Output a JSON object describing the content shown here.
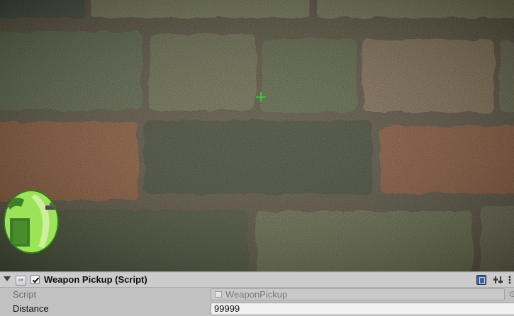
{
  "game_view": {
    "scene": "stone-brick-wall",
    "crosshair_icon": "crosshair-icon",
    "crosshair_color": "#3cd43c",
    "radar_icon": "radar-minimap-icon",
    "radar_color": "#6fd63a"
  },
  "inspector": {
    "component": {
      "title": "Weapon Pickup (Script)",
      "enabled": true,
      "icons": [
        "foldout-arrow-icon",
        "csharp-script-icon",
        "help-book-icon",
        "settings-icon",
        "context-menu-icon"
      ]
    },
    "properties": {
      "script": {
        "label": "Script",
        "value": "WeaponPickup"
      },
      "distance": {
        "label": "Distance",
        "value": "99999"
      }
    },
    "colors": {
      "panel_bg": "#c2c2c2",
      "header_bg": "#cbcbcb",
      "disabled_text": "#7a7a7a"
    }
  }
}
